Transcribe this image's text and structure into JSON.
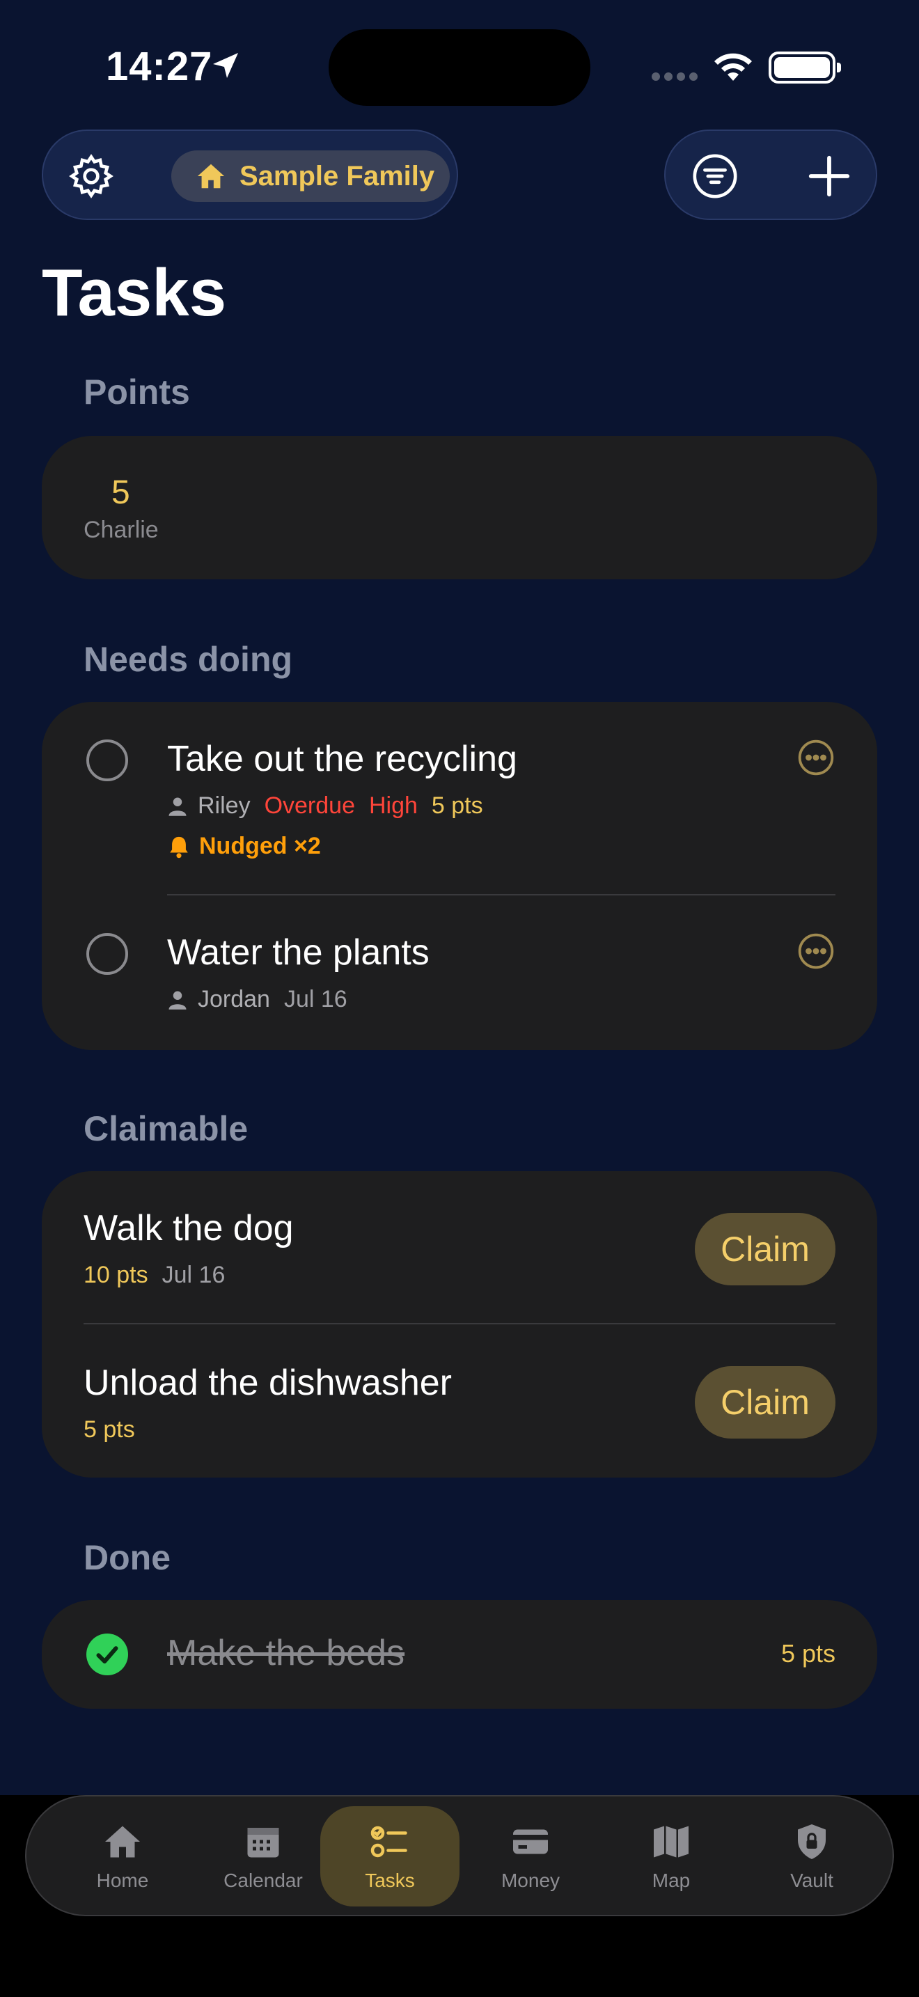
{
  "status_bar": {
    "time": "14:27"
  },
  "header": {
    "family_name": "Sample Family",
    "page_title": "Tasks"
  },
  "points": {
    "header": "Points",
    "entries": [
      {
        "value": "5",
        "name": "Charlie"
      }
    ]
  },
  "needs_doing": {
    "header": "Needs doing",
    "tasks": [
      {
        "title": "Take out the recycling",
        "assignee": "Riley",
        "status": "Overdue",
        "priority": "High",
        "points": "5 pts",
        "nudge": "Nudged ×2"
      },
      {
        "title": "Water the plants",
        "assignee": "Jordan",
        "due": "Jul 16"
      }
    ]
  },
  "claimable": {
    "header": "Claimable",
    "tasks": [
      {
        "title": "Walk the dog",
        "points": "10 pts",
        "due": "Jul 16",
        "button": "Claim"
      },
      {
        "title": "Unload the dishwasher",
        "points": "5 pts",
        "button": "Claim"
      }
    ]
  },
  "done": {
    "header": "Done",
    "tasks": [
      {
        "title": "Make the beds",
        "points": "5 pts"
      }
    ]
  },
  "tab_bar": {
    "active": "Tasks",
    "items": [
      {
        "label": "Home",
        "icon": "house-icon"
      },
      {
        "label": "Calendar",
        "icon": "calendar-icon"
      },
      {
        "label": "Tasks",
        "icon": "checklist-icon"
      },
      {
        "label": "Money",
        "icon": "card-icon"
      },
      {
        "label": "Map",
        "icon": "map-icon"
      },
      {
        "label": "Vault",
        "icon": "lock-shield-icon"
      }
    ]
  },
  "colors": {
    "background": "#0a1430",
    "accent_gold": "#f0c85a",
    "overdue_red": "#ff453a",
    "nudge_orange": "#ff9f0a",
    "done_green": "#30d158"
  }
}
